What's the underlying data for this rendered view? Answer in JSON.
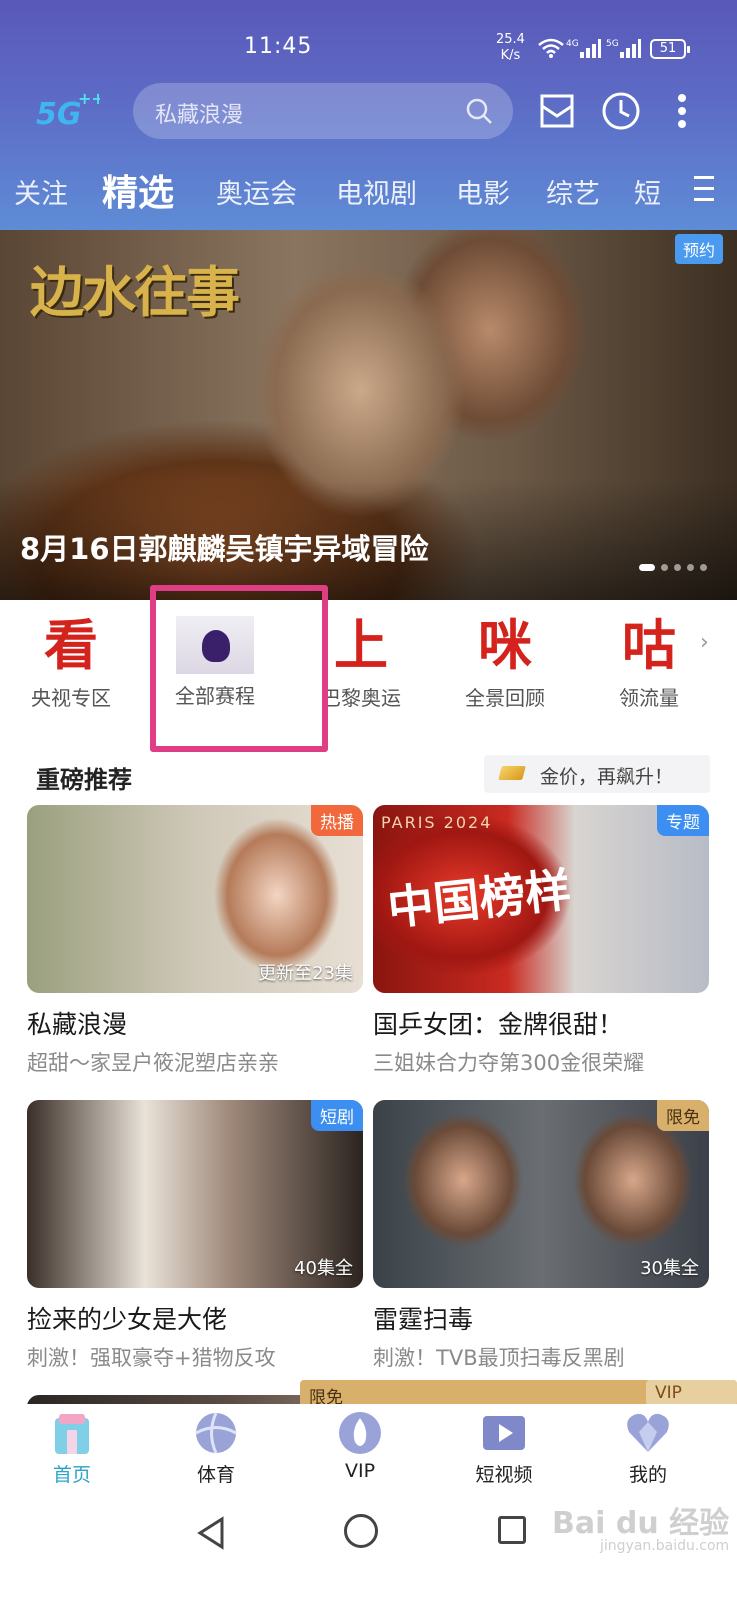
{
  "status_bar": {
    "time": "11:45",
    "speed_value": "25.4",
    "speed_unit": "K/s",
    "battery": "51"
  },
  "header": {
    "logo": "5G++",
    "search_placeholder": "私藏浪漫",
    "icons": [
      "search-icon",
      "mail-icon",
      "history-icon",
      "more-icon"
    ]
  },
  "tabs": [
    "关注",
    "精选",
    "奥运会",
    "电视剧",
    "电影",
    "综艺",
    "短"
  ],
  "active_tab": "精选",
  "banner": {
    "art_title": "边水往事",
    "caption": "8月16日郭麒麟吴镇宇异域冒险",
    "badge": "预约",
    "slide_count": 5,
    "active_slide": 1
  },
  "quick_entries": [
    {
      "glyph": "看",
      "label": "央视专区"
    },
    {
      "glyph": "",
      "label": "全部赛程"
    },
    {
      "glyph": "上",
      "label": "巴黎奥运"
    },
    {
      "glyph": "咪",
      "label": "全景回顾"
    },
    {
      "glyph": "咕",
      "label": "领流量"
    }
  ],
  "section": {
    "title": "重磅推荐",
    "chip_text": "金价，再飙升！"
  },
  "cards": [
    {
      "badge": "热播",
      "episode": "更新至23集",
      "title": "私藏浪漫",
      "subtitle": "超甜～家昱户筱泥塑店亲亲"
    },
    {
      "badge": "专题",
      "episode": "",
      "title": "国乒女团：金牌很甜！",
      "subtitle": "三姐妹合力夺第300金很荣耀",
      "art_top": "PARIS 2024",
      "art_big": "中国榜样"
    },
    {
      "badge": "短剧",
      "episode": "40集全",
      "title": "捡来的少女是大佬",
      "subtitle": "刺激！强取豪夺+猎物反攻"
    },
    {
      "badge": "限免",
      "episode": "30集全",
      "title": "雷霆扫毒",
      "subtitle": "刺激！TVB最顶扫毒反黑剧"
    },
    {
      "badge": "限免",
      "episode": "",
      "title": "",
      "subtitle": ""
    },
    {
      "badge": "VIP",
      "episode": "",
      "title": "",
      "subtitle": ""
    }
  ],
  "bottom_nav": [
    {
      "label": "首页",
      "icon": "home-icon",
      "active": true
    },
    {
      "label": "体育",
      "icon": "sports-icon",
      "active": false
    },
    {
      "label": "VIP",
      "icon": "vip-icon",
      "active": false
    },
    {
      "label": "短视频",
      "icon": "short-video-icon",
      "active": false
    },
    {
      "label": "我的",
      "icon": "profile-icon",
      "active": false
    }
  ],
  "watermark": {
    "text": "Bai du 经验",
    "sub": "jingyan.baidu.com"
  },
  "colors": {
    "header_top": "#5a58b8",
    "header_bottom": "#5e8cd6",
    "highlight_box": "#df3d84",
    "nav_active": "#2aa4c8",
    "quick_glyph": "#d4221c"
  }
}
